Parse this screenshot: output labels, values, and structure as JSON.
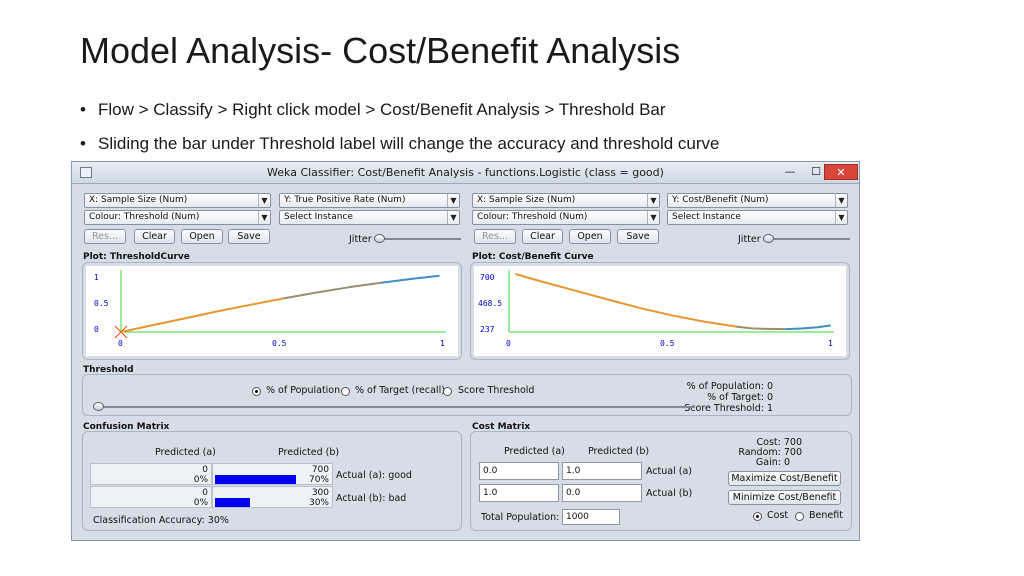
{
  "slide": {
    "title": "Model Analysis- Cost/Benefit Analysis",
    "bullets": [
      "Flow > Classify > Right click model > Cost/Benefit Analysis > Threshold Bar",
      "Sliding the bar under Threshold label will change the accuracy and threshold curve"
    ],
    "bullet_glyph": "•"
  },
  "window": {
    "title": "Weka Classifier: Cost/Benefit Analysis - functions.Logistic  (class = good)",
    "minimize_glyph": "—",
    "maximize_glyph": "☐",
    "close_glyph": "✕"
  },
  "left": {
    "x_axis": "X: Sample Size (Num)",
    "y_axis": "Y: True Positive Rate (Num)",
    "colour": "Colour: Threshold (Num)",
    "select": "Select Instance",
    "reset": "Res...",
    "clear": "Clear",
    "open": "Open",
    "save": "Save",
    "jitter": "Jitter",
    "plot_title": "Plot: ThresholdCurve",
    "y_ticks": [
      "1",
      "0.5",
      "0"
    ],
    "x_ticks": [
      "0",
      "0.5",
      "1"
    ]
  },
  "right": {
    "x_axis": "X: Sample Size (Num)",
    "y_axis": "Y: Cost/Benefit (Num)",
    "colour": "Colour: Threshold (Num)",
    "select": "Select Instance",
    "reset": "Res...",
    "clear": "Clear",
    "open": "Open",
    "save": "Save",
    "jitter": "Jitter",
    "plot_title": "Plot: Cost/Benefit Curve",
    "y_ticks": [
      "700",
      "468.5",
      "237"
    ],
    "x_ticks": [
      "0",
      "0.5",
      "1"
    ]
  },
  "threshold": {
    "label": "Threshold",
    "radio_population": "% of Population",
    "radio_target": "% of Target (recall)",
    "radio_score": "Score Threshold",
    "selected": "population",
    "pop_readout": "% of Population: 0",
    "target_readout": "% of Target: 0",
    "score_readout": "Score Threshold: 1",
    "slider_value": 0
  },
  "confusion": {
    "label": "Confusion Matrix",
    "pred_a": "Predicted (a)",
    "pred_b": "Predicted (b)",
    "rows": [
      {
        "a_count": "0",
        "a_pct": "0%",
        "b_count": "700",
        "b_pct": "70%",
        "actual": "Actual (a): good",
        "a_fill": 0.0,
        "b_fill": 0.7
      },
      {
        "a_count": "0",
        "a_pct": "0%",
        "b_count": "300",
        "b_pct": "30%",
        "actual": "Actual (b): bad",
        "a_fill": 0.0,
        "b_fill": 0.3
      }
    ],
    "accuracy": "Classification Accuracy:  30%"
  },
  "cost": {
    "label": "Cost Matrix",
    "pred_a": "Predicted (a)",
    "pred_b": "Predicted (b)",
    "r1": [
      "0.0",
      "1.0"
    ],
    "r2": [
      "1.0",
      "0.0"
    ],
    "actual_a": "Actual (a)",
    "actual_b": "Actual (b)",
    "total_label": "Total Population:",
    "total_value": "1000",
    "cost_readout": "Cost: 700",
    "random_readout": "Random: 700",
    "gain_readout": "Gain: 0",
    "maximize": "Maximize Cost/Benefit",
    "minimize": "Minimize Cost/Benefit",
    "radio_cost": "Cost",
    "radio_benefit": "Benefit",
    "selected": "cost"
  },
  "chart_data": [
    {
      "type": "line",
      "title": "Plot: ThresholdCurve",
      "xlim": [
        0,
        1
      ],
      "ylim": [
        0,
        1
      ],
      "x": [
        0,
        0.1,
        0.2,
        0.3,
        0.4,
        0.5,
        0.6,
        0.7,
        0.8,
        0.9,
        0.98
      ],
      "y": [
        0,
        0.12,
        0.24,
        0.36,
        0.47,
        0.58,
        0.68,
        0.77,
        0.85,
        0.92,
        0.97
      ]
    },
    {
      "type": "line",
      "title": "Plot: Cost/Benefit Curve",
      "xlim": [
        0,
        1
      ],
      "ylim": [
        237,
        700
      ],
      "x": [
        0.02,
        0.1,
        0.2,
        0.3,
        0.4,
        0.5,
        0.6,
        0.7,
        0.75,
        0.8,
        0.85,
        0.9,
        0.95,
        0.99
      ],
      "y": [
        700,
        640,
        570,
        500,
        430,
        370,
        320,
        280,
        265,
        262,
        260,
        265,
        275,
        290
      ]
    }
  ]
}
